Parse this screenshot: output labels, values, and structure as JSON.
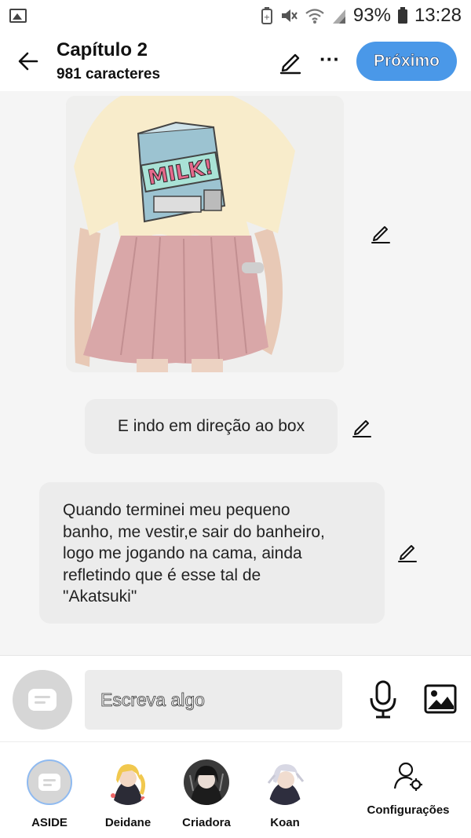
{
  "status_bar": {
    "battery_percent": "93%",
    "time": "13:28",
    "icons": [
      "gallery-icon",
      "battery-saver-icon",
      "mute-icon",
      "wifi-icon",
      "signal-icon",
      "battery-icon"
    ]
  },
  "header": {
    "title": "Capítulo 2",
    "subtitle": "981 caracteres",
    "next_label": "Próximo"
  },
  "content": {
    "image_label": "MILK!",
    "messages": [
      {
        "text": "E indo em direção ao box"
      },
      {
        "text": "Quando terminei meu pequeno\nbanho, me vestir,e sair do banheiro,\nlogo me jogando na cama, ainda\nrefletindo que é esse tal de\n\"Akatsuki\""
      }
    ]
  },
  "composer": {
    "placeholder": "Escreva algo"
  },
  "bottom_nav": {
    "items": [
      {
        "label": "ASIDE"
      },
      {
        "label": "Deidane"
      },
      {
        "label": "Criadora"
      },
      {
        "label": "Koan"
      }
    ],
    "settings_label": "Configurações"
  },
  "colors": {
    "accent": "#4a98e8",
    "bubble": "#ececec",
    "background": "#f5f5f5"
  }
}
